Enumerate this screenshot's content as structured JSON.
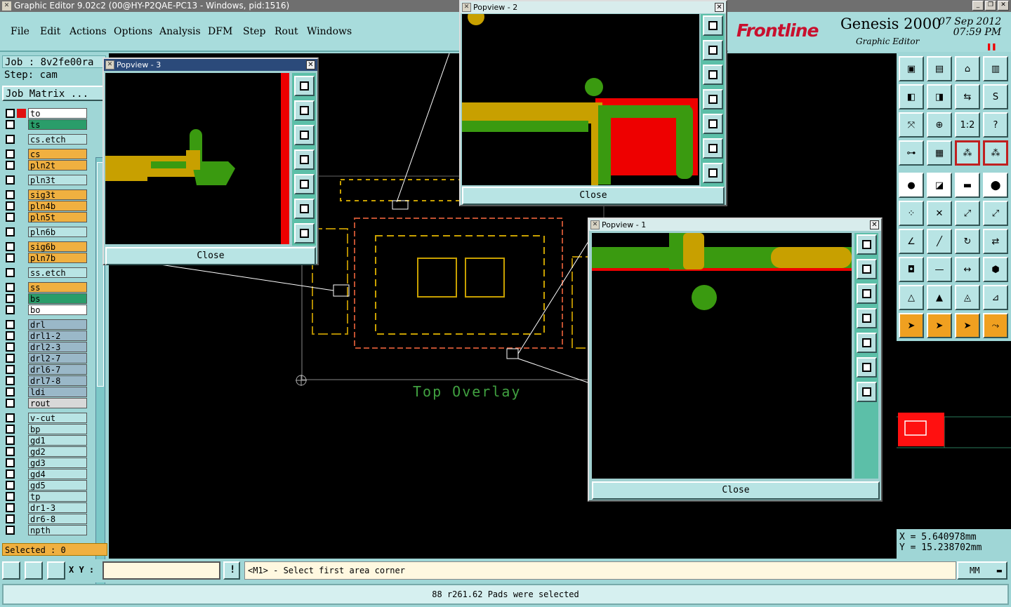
{
  "window": {
    "title": "Graphic Editor 9.02c2 (00@HY-P2QAE-PC13 - Windows, pid:1516)"
  },
  "menu": [
    "File",
    "Edit",
    "Actions",
    "Options",
    "Analysis",
    "DFM",
    "Step",
    "Rout",
    "Windows"
  ],
  "brand": {
    "logo": "Frontline",
    "product": "Genesis 2000",
    "subtitle": "Graphic Editor",
    "date": "07 Sep 2012",
    "time": "07:59 PM"
  },
  "job": {
    "job_label": "Job : 8v2fe00ra",
    "step_label": "Step: cam",
    "matrix_button": "Job Matrix ..."
  },
  "layers": [
    {
      "name": "to",
      "color": "#ffffff"
    },
    {
      "name": "ts",
      "color": "#2a9d6a"
    },
    {
      "name": "cs.etch",
      "color": "#b8e4e4"
    },
    {
      "name": "cs",
      "color": "#f0b040"
    },
    {
      "name": "pln2t",
      "color": "#f0b040"
    },
    {
      "name": "pln3t",
      "color": "#b8e4e4"
    },
    {
      "name": "sig3t",
      "color": "#f0b040"
    },
    {
      "name": "pln4b",
      "color": "#f0b040"
    },
    {
      "name": "pln5t",
      "color": "#f0b040"
    },
    {
      "name": "pln6b",
      "color": "#b8e4e4"
    },
    {
      "name": "sig6b",
      "color": "#f0b040"
    },
    {
      "name": "pln7b",
      "color": "#f0b040"
    },
    {
      "name": "ss.etch",
      "color": "#b8e4e4"
    },
    {
      "name": "ss",
      "color": "#f0b040"
    },
    {
      "name": "bs",
      "color": "#2a9d6a"
    },
    {
      "name": "bo",
      "color": "#ffffff"
    },
    {
      "name": "drl",
      "color": "#9ab8c8"
    },
    {
      "name": "drl1-2",
      "color": "#9ab8c8"
    },
    {
      "name": "drl2-3",
      "color": "#9ab8c8"
    },
    {
      "name": "drl2-7",
      "color": "#9ab8c8"
    },
    {
      "name": "drl6-7",
      "color": "#9ab8c8"
    },
    {
      "name": "drl7-8",
      "color": "#9ab8c8"
    },
    {
      "name": "ldi",
      "color": "#9ab8c8"
    },
    {
      "name": "rout",
      "color": "#d8d8d8"
    },
    {
      "name": "v-cut",
      "color": "#b8e4e4"
    },
    {
      "name": "bp",
      "color": "#b8e4e4"
    },
    {
      "name": "gd1",
      "color": "#b8e4e4"
    },
    {
      "name": "gd2",
      "color": "#b8e4e4"
    },
    {
      "name": "gd3",
      "color": "#b8e4e4"
    },
    {
      "name": "gd4",
      "color": "#b8e4e4"
    },
    {
      "name": "gd5",
      "color": "#b8e4e4"
    },
    {
      "name": "tp",
      "color": "#b8e4e4"
    },
    {
      "name": "dr1-3",
      "color": "#b8e4e4"
    },
    {
      "name": "dr6-8",
      "color": "#b8e4e4"
    },
    {
      "name": "npth",
      "color": "#b8e4e4"
    }
  ],
  "selected_label": "Selected : 0",
  "canvas": {
    "overlay_text": "Top Overlay"
  },
  "popups": [
    {
      "title": "Popview - 3",
      "close": "Close"
    },
    {
      "title": "Popview - 2",
      "close": "Close"
    },
    {
      "title": "Popview - 1",
      "close": "Close"
    }
  ],
  "tools": {
    "scale_label": "1:2",
    "help_label": "?"
  },
  "coords": {
    "x": "X = 5.640978mm",
    "y": "Y = 15.238702mm"
  },
  "command": {
    "xy_label": "X Y :",
    "xy_value": "",
    "prompt": "<M1> - Select first area corner",
    "units": "MM"
  },
  "status": "88 r261.62 Pads were selected"
}
